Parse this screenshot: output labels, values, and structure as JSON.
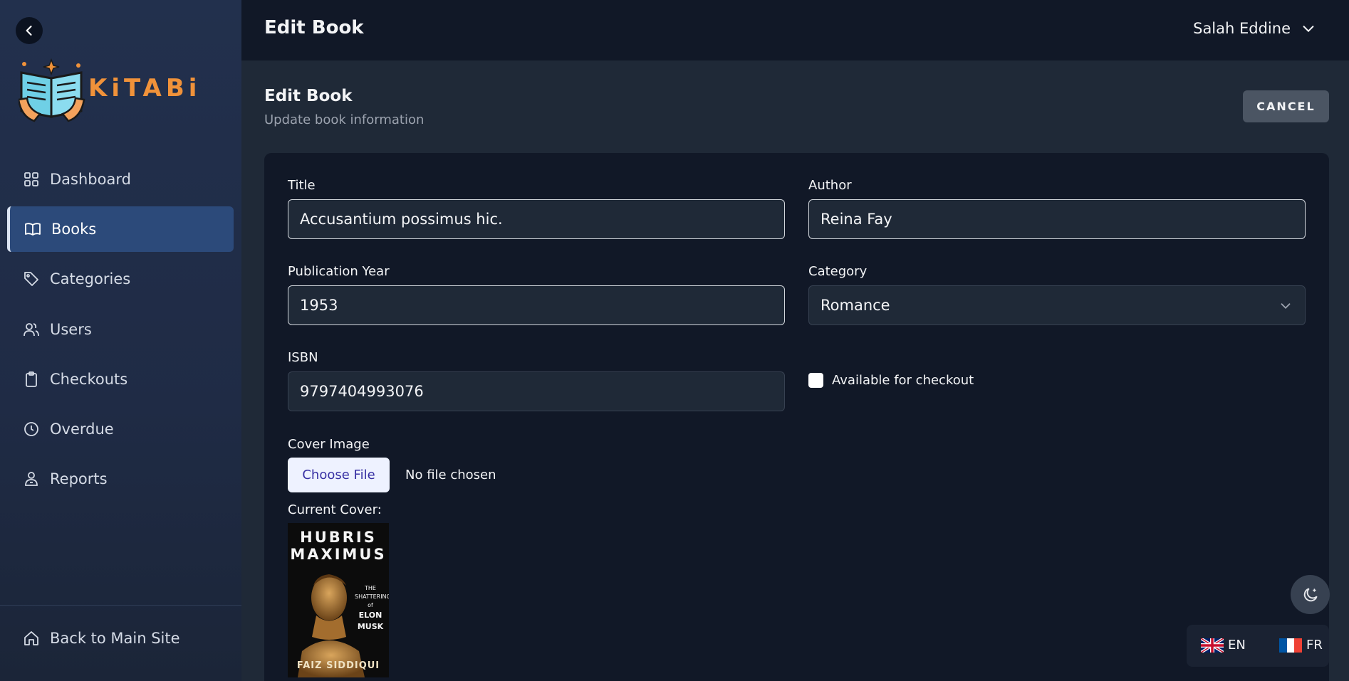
{
  "sidebar": {
    "logo_text": "KiTABi",
    "items": [
      {
        "label": "Dashboard",
        "icon": "grid-icon",
        "active": false
      },
      {
        "label": "Books",
        "icon": "book-open-icon",
        "active": true
      },
      {
        "label": "Categories",
        "icon": "tag-icon",
        "active": false
      },
      {
        "label": "Users",
        "icon": "users-icon",
        "active": false
      },
      {
        "label": "Checkouts",
        "icon": "clipboard-icon",
        "active": false
      },
      {
        "label": "Overdue",
        "icon": "clock-icon",
        "active": false
      },
      {
        "label": "Reports",
        "icon": "reports-user-icon",
        "active": false
      }
    ],
    "back_to_main": "Back to Main Site"
  },
  "topbar": {
    "title": "Edit Book",
    "user_name": "Salah Eddine"
  },
  "header": {
    "title": "Edit Book",
    "subtitle": "Update book information",
    "cancel_label": "CANCEL"
  },
  "form": {
    "title_label": "Title",
    "title_value": "Accusantium possimus hic.",
    "author_label": "Author",
    "author_value": "Reina Fay",
    "year_label": "Publication Year",
    "year_value": "1953",
    "category_label": "Category",
    "category_value": "Romance",
    "isbn_label": "ISBN",
    "isbn_value": "9797404993076",
    "available_label": "Available for checkout",
    "available_checked": false,
    "cover_label": "Cover Image",
    "choose_file_label": "Choose File",
    "no_file_text": "No file chosen",
    "current_cover_label": "Current Cover:"
  },
  "cover": {
    "line1": "HUBRIS",
    "line2": "MAXIMUS",
    "small1": "THE",
    "small2": "SHATTERING",
    "small3": "of",
    "small4": "ELON",
    "small5": "MUSK",
    "author": "FAIZ SIDDIQUI"
  },
  "languages": [
    {
      "code": "EN",
      "flag": "uk-flag-icon"
    },
    {
      "code": "FR",
      "flag": "france-flag-icon"
    }
  ],
  "colors": {
    "sidebar_bg": "#22304d",
    "active_item": "#2c4a7a",
    "topbar_bg": "#111827",
    "content_bg": "#1f2937",
    "logo_orange": "#f0923a"
  }
}
